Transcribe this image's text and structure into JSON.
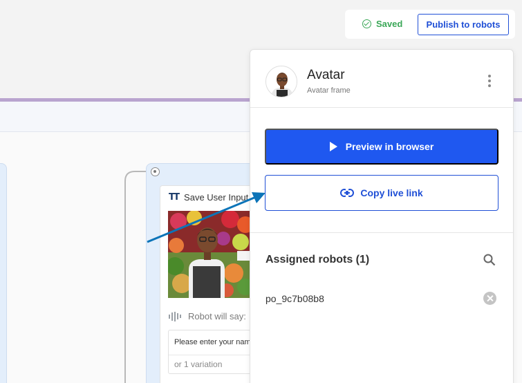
{
  "status": {
    "saved_label": "Saved",
    "publish_label": "Publish to robots"
  },
  "flow_node": {
    "title": "Save User Input",
    "robot_say_label": "Robot will say:",
    "say_text": "Please enter your name",
    "variations": "or 1 variation"
  },
  "panel": {
    "title": "Avatar",
    "subtitle": "Avatar frame",
    "preview_label": "Preview in browser",
    "copy_label": "Copy live link",
    "assigned_title": "Assigned robots (1)",
    "robots": [
      {
        "id": "po_9c7b08b8"
      }
    ]
  },
  "colors": {
    "accent": "#1f58f0",
    "outline": "#1f4fd6",
    "saved": "#3aa757",
    "arrow": "#0c74b8",
    "header_stripe": "#b9a4cf"
  },
  "icons": [
    "check-circle-icon",
    "kebab-menu-icon",
    "play-icon",
    "link-icon",
    "search-icon",
    "remove-icon",
    "text-type-icon",
    "audio-wave-icon",
    "annotation-arrow"
  ]
}
